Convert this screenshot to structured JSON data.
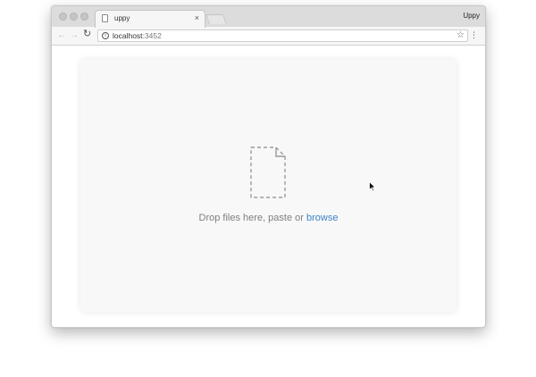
{
  "browser": {
    "tab": {
      "title": "uppy",
      "close_glyph": "×"
    },
    "profile_label": "Uppy",
    "toolbar": {
      "back_glyph": "←",
      "forward_glyph": "→",
      "reload_glyph": "↻",
      "url_host": "localhost",
      "url_port": ":3452",
      "star_glyph": "☆",
      "menu_glyph": "⋮",
      "info_glyph": "i"
    }
  },
  "dashboard": {
    "drop_text": "Drop files here, paste or",
    "browse_label": "browse",
    "icons": [
      "file-icon"
    ]
  },
  "colors": {
    "accent": "#3c84c3",
    "text_muted": "#7f7f7f",
    "panel_bg": "#f8f8f9"
  }
}
